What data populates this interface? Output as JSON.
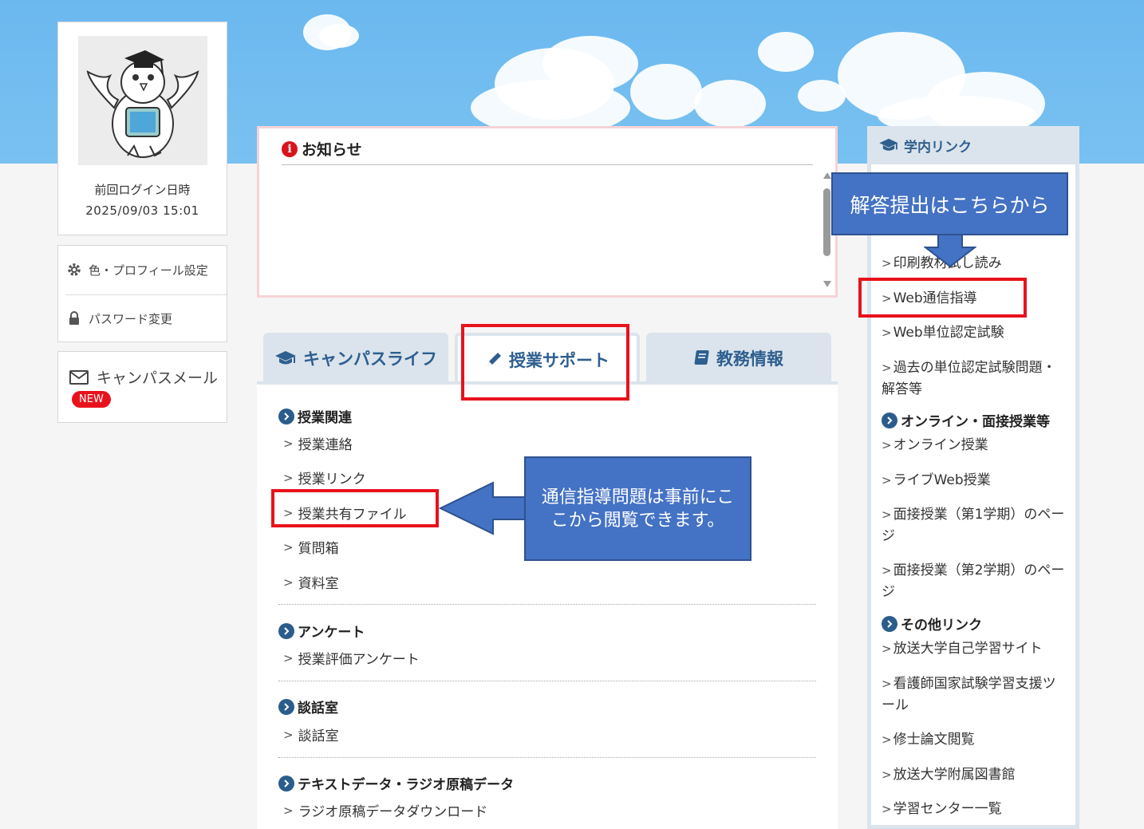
{
  "profile": {
    "login_label": "前回ログイン日時",
    "login_datetime": "2025/09/03 15:01"
  },
  "settings": {
    "color_profile": "色・プロフィール設定",
    "password_change": "パスワード変更"
  },
  "mail": {
    "label": "キャンパスメール",
    "badge": "NEW"
  },
  "notice": {
    "title": "お知らせ"
  },
  "tabs": [
    {
      "label": "キャンパスライフ",
      "icon": "graduation-cap-icon"
    },
    {
      "label": "授業サポート",
      "icon": "pencil-icon"
    },
    {
      "label": "教務情報",
      "icon": "book-icon"
    }
  ],
  "content": {
    "sections": [
      {
        "title": "授業関連",
        "items": [
          "授業連絡",
          "授業リンク",
          "授業共有ファイル",
          "質問箱",
          "資料室"
        ]
      },
      {
        "title": "アンケート",
        "items": [
          "授業評価アンケート"
        ]
      },
      {
        "title": "談話室",
        "items": [
          "談話室"
        ]
      },
      {
        "title": "テキストデータ・ラジオ原稿データ",
        "items": [
          "ラジオ原稿データダウンロード"
        ]
      }
    ]
  },
  "sidebar": {
    "title": "学内リンク",
    "links_top": [
      "印刷教材試し読み",
      "Web通信指導",
      "Web単位認定試験",
      "過去の単位認定試験問題・解答等"
    ],
    "section_online": "オンライン・面接授業等",
    "links_online": [
      "オンライン授業",
      "ライブWeb授業",
      "面接授業（第1学期）のページ",
      "面接授業（第2学期）のページ"
    ],
    "section_other": "その他リンク",
    "links_other": [
      "放送大学自己学習サイト",
      "看護師国家試験学習支援ツール",
      "修士論文閲覧",
      "放送大学附属図書館",
      "学習センター一覧"
    ]
  },
  "annotations": {
    "answer_callout": "解答提出はこちらから",
    "problem_callout": "通信指導問題は事前にここから閲覧できます。"
  },
  "colors": {
    "accent": "#2e5f8f",
    "highlight": "#e8121c",
    "callout": "#4472c4"
  }
}
